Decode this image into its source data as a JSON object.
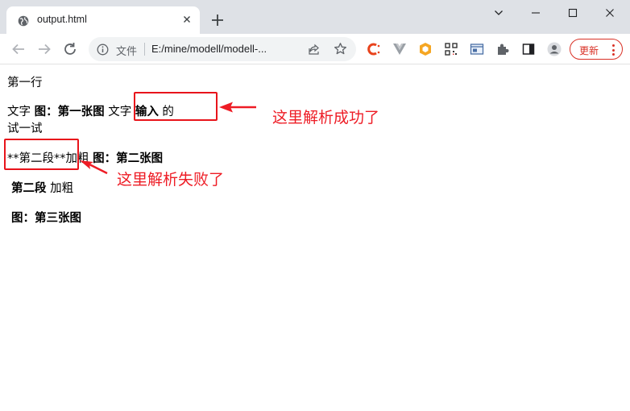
{
  "tab": {
    "title": "output.html"
  },
  "omnibox": {
    "file_label": "文件",
    "url": "E:/mine/modell/modell-..."
  },
  "update_button": {
    "label": "更新"
  },
  "page": {
    "line1": "第一行",
    "line2": {
      "t1": "文字 ",
      "b1": "图：第一张图",
      "t2": " 文字 ",
      "b2": "输入",
      "t3": " 的"
    },
    "line3": "试一试",
    "line4": {
      "t1": "**第二段**加粗 ",
      "b1": "图：第二张图"
    },
    "line5": {
      "b1": "第二段",
      "t1": " 加粗"
    },
    "line6": {
      "b1": "图：第三张图"
    }
  },
  "annotations": {
    "success": "这里解析成功了",
    "failure": "这里解析失败了"
  },
  "colors": {
    "annotation_red": "#ee1c25",
    "chrome_gray": "#dee1e6"
  }
}
